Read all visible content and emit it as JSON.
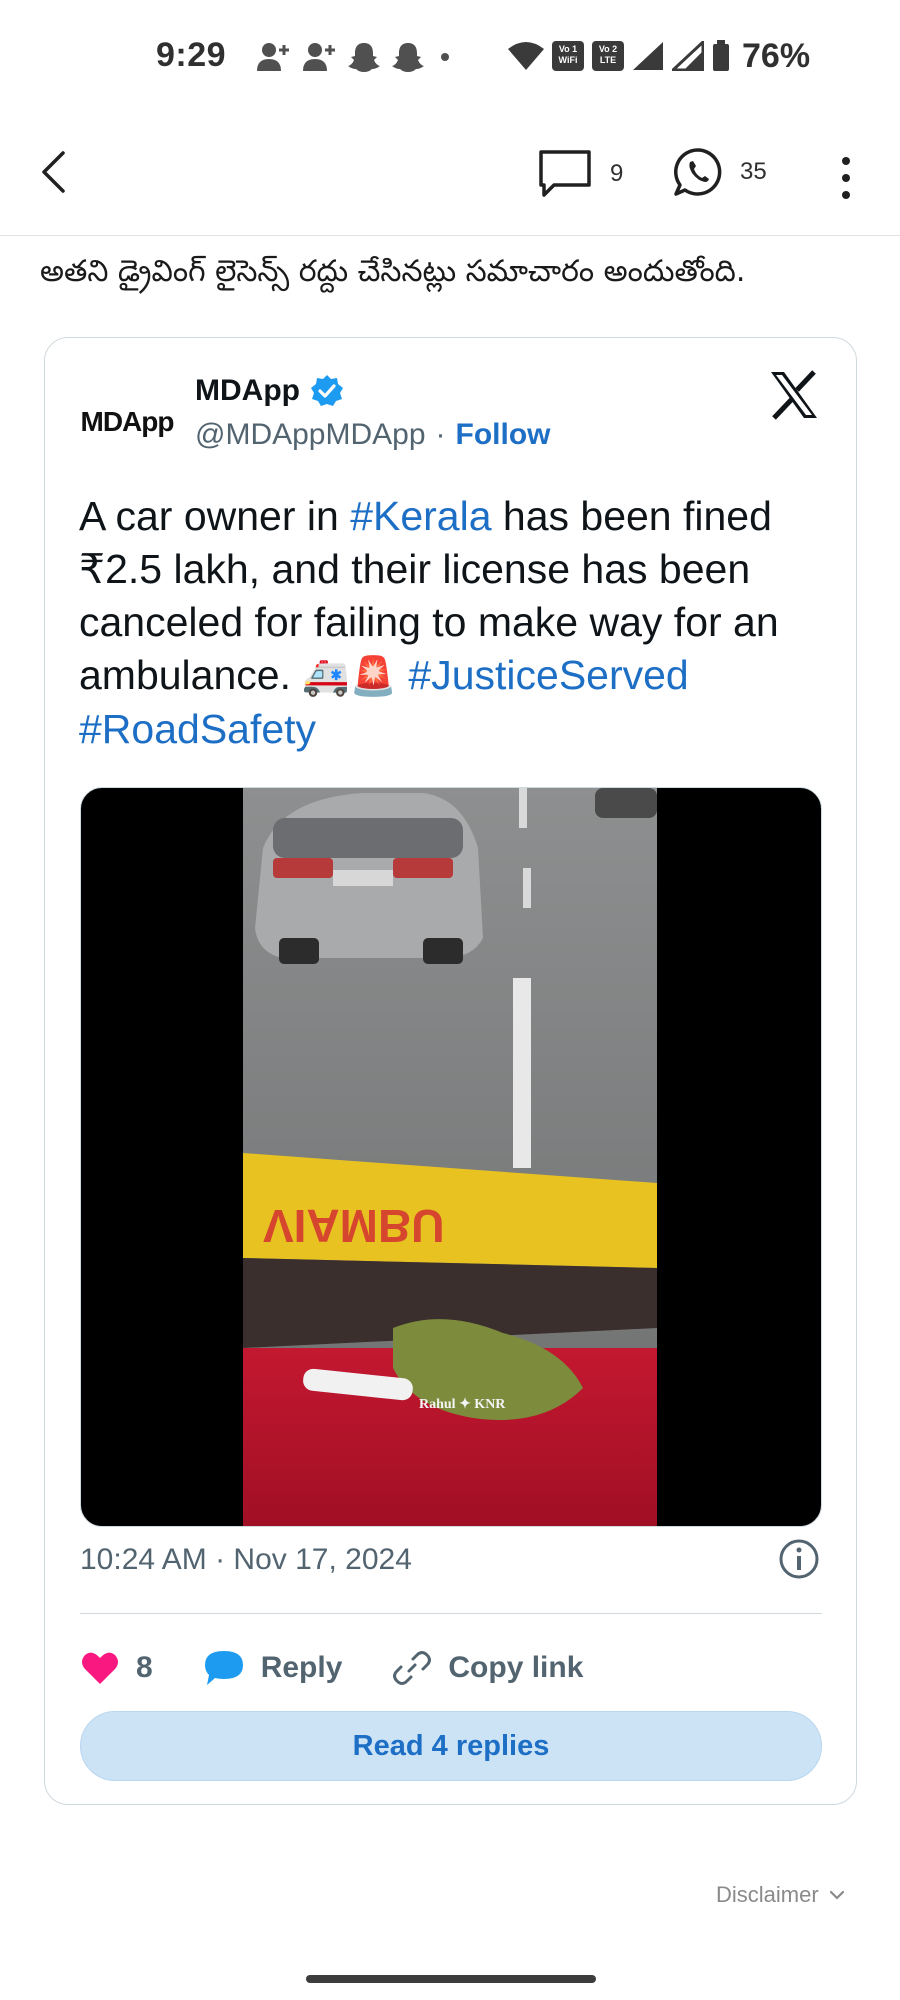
{
  "status_bar": {
    "time": "9:29",
    "battery": "76%",
    "icons": [
      "person-add-icon",
      "person-add-icon",
      "snapchat-icon",
      "snapchat-icon",
      "dot-icon",
      "wifi-icon",
      "vowifi-icon",
      "volte-icon",
      "signal-icon",
      "signal-icon",
      "battery-icon"
    ],
    "vowifi_label": "Vo 1 WiFi",
    "volte_label": "Vo 2 LTE"
  },
  "app_bar": {
    "comment_count": "9",
    "whatsapp_count": "35"
  },
  "article": {
    "text": "అతని డ్రైవింగ్ లైసెన్స్ రద్దు చేసినట్లు సమాచారం అందుతోంది."
  },
  "tweet": {
    "avatar_text": "MDApp",
    "name": "MDApp",
    "handle": "@MDAppMDApp",
    "separator": "·",
    "follow_label": "Follow",
    "body_part1": "A car owner in ",
    "hashtag_kerala": "#Kerala",
    "body_part2": " has been fined ₹2.5 lakh, and their license has been canceled for failing to make way for an ambulance. ",
    "emoji": "🚑🚨",
    "hashtag_justice": "#JusticeServed",
    "hashtag_road": "#RoadSafety",
    "video_watermark": "Rahul ✦ KNR",
    "timestamp": "10:24 AM · Nov 17, 2024",
    "like_count": "8",
    "reply_label": "Reply",
    "copy_link_label": "Copy link",
    "read_replies_label": "Read 4 replies"
  },
  "footer": {
    "disclaimer_label": "Disclaimer"
  },
  "colors": {
    "accent_blue": "#1d6ec5",
    "like_pink": "#f91880",
    "reply_blue": "#1d9bf0",
    "card_border": "#cfd9de",
    "muted_text": "#536471"
  }
}
